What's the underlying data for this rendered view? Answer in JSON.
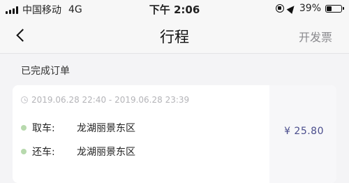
{
  "status_bar": {
    "carrier": "中国移动",
    "network": "4G",
    "time": "下午 2:06",
    "battery_text": "39%",
    "battery_level": 0.39
  },
  "nav": {
    "title": "行程",
    "action_label": "开发票"
  },
  "section": {
    "title": "已完成订单"
  },
  "order": {
    "time_range": "2019.06.28 22:40 - 2019.06.28 23:39",
    "pickup_label": "取车:",
    "pickup_location": "龙湖丽景东区",
    "return_label": "还车:",
    "return_location": "龙湖丽景东区",
    "price": "¥ 25.80",
    "dot_color": "#b7d9ad",
    "price_color": "#4a4d8c"
  }
}
